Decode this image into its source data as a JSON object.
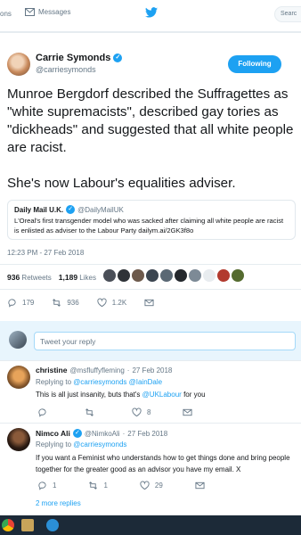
{
  "nav": {
    "notifications_label": "ons",
    "messages_label": "Messages",
    "search_placeholder": "Searc"
  },
  "tweet": {
    "author_name": "Carrie Symonds",
    "author_handle": "@carriesymonds",
    "follow_label": "Following",
    "paragraphs": [
      "Munroe Bergdorf described the Suffragettes as \"white supremacists\", described gay tories as \"dickheads\" and suggested that all white people are racist.",
      "She's now Labour's equalities adviser."
    ],
    "quote": {
      "name": "Daily Mail U.K.",
      "handle": "@DailyMailUK",
      "text": "L'Oreal's first transgender model who was sacked after claiming all white people are racist is enlisted as adviser to the Labour Party dailym.ai/2GK3f8o"
    },
    "timestamp": "12:23 PM - 27 Feb 2018",
    "retweets_count": "936",
    "retweets_label": "Retweets",
    "likes_count": "1,189",
    "likes_label": "Likes",
    "actions": {
      "replies": "179",
      "retweets": "936",
      "likes": "1.2K"
    }
  },
  "reply_box": {
    "placeholder": "Tweet your reply"
  },
  "replies": [
    {
      "name": "christine",
      "handle": "@msfluffyfleming",
      "date": "27 Feb 2018",
      "replying_prefix": "Replying to",
      "replying_to": "@carriesymonds @IainDale",
      "text_before": "This is all just insanity, buts that's",
      "text_link": "@UKLabour",
      "text_after": "for you",
      "replies": "",
      "retweets": "",
      "likes": "8"
    },
    {
      "name": "Nimco Ali",
      "handle": "@NimkoAli",
      "date": "27 Feb 2018",
      "replying_prefix": "Replying to",
      "replying_to": "@carriesymonds",
      "text": "If you want a Feminist who understands how to get things done and bring people together for the greater good as an advisor you have my email. X",
      "replies": "1",
      "retweets": "1",
      "likes": "29"
    }
  ],
  "more_replies": "2 more replies",
  "colors": {
    "accent": "#1da1f2",
    "text": "#14171a",
    "muted": "#657786"
  }
}
